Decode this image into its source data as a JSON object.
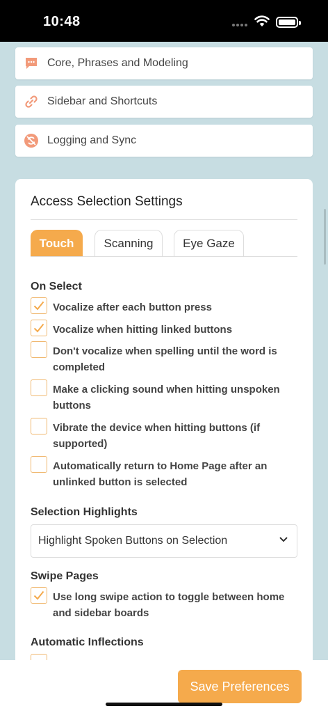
{
  "status_bar": {
    "time": "10:48"
  },
  "menu_items": [
    {
      "label": "Core, Phrases and Modeling",
      "icon": "chat-bubble-icon"
    },
    {
      "label": "Sidebar and Shortcuts",
      "icon": "link-icon"
    },
    {
      "label": "Logging and Sync",
      "icon": "sync-off-icon"
    }
  ],
  "access_settings": {
    "title": "Access Selection Settings",
    "tabs": [
      {
        "label": "Touch",
        "active": true
      },
      {
        "label": "Scanning",
        "active": false
      },
      {
        "label": "Eye Gaze",
        "active": false
      }
    ],
    "on_select": {
      "heading": "On Select",
      "options": [
        {
          "label": "Vocalize after each button press",
          "checked": true
        },
        {
          "label": "Vocalize when hitting linked buttons",
          "checked": true
        },
        {
          "label": "Don't vocalize when spelling until the word is completed",
          "checked": false
        },
        {
          "label": "Make a clicking sound when hitting unspoken buttons",
          "checked": false
        },
        {
          "label": "Vibrate the device when hitting buttons (if supported)",
          "checked": false
        },
        {
          "label": "Automatically return to Home Page after an unlinked button is selected",
          "checked": false
        }
      ]
    },
    "selection_highlights": {
      "heading": "Selection Highlights",
      "selected": "Highlight Spoken Buttons on Selection"
    },
    "swipe_pages": {
      "heading": "Swipe Pages",
      "options": [
        {
          "label": "Use long swipe action to toggle between home and sidebar boards",
          "checked": true
        }
      ]
    },
    "automatic_inflections": {
      "heading": "Automatic Inflections"
    }
  },
  "footer": {
    "save_label": "Save Preferences"
  },
  "colors": {
    "accent": "#f5aa4c",
    "icon": "#f29a7a",
    "background": "#c7dde2"
  }
}
